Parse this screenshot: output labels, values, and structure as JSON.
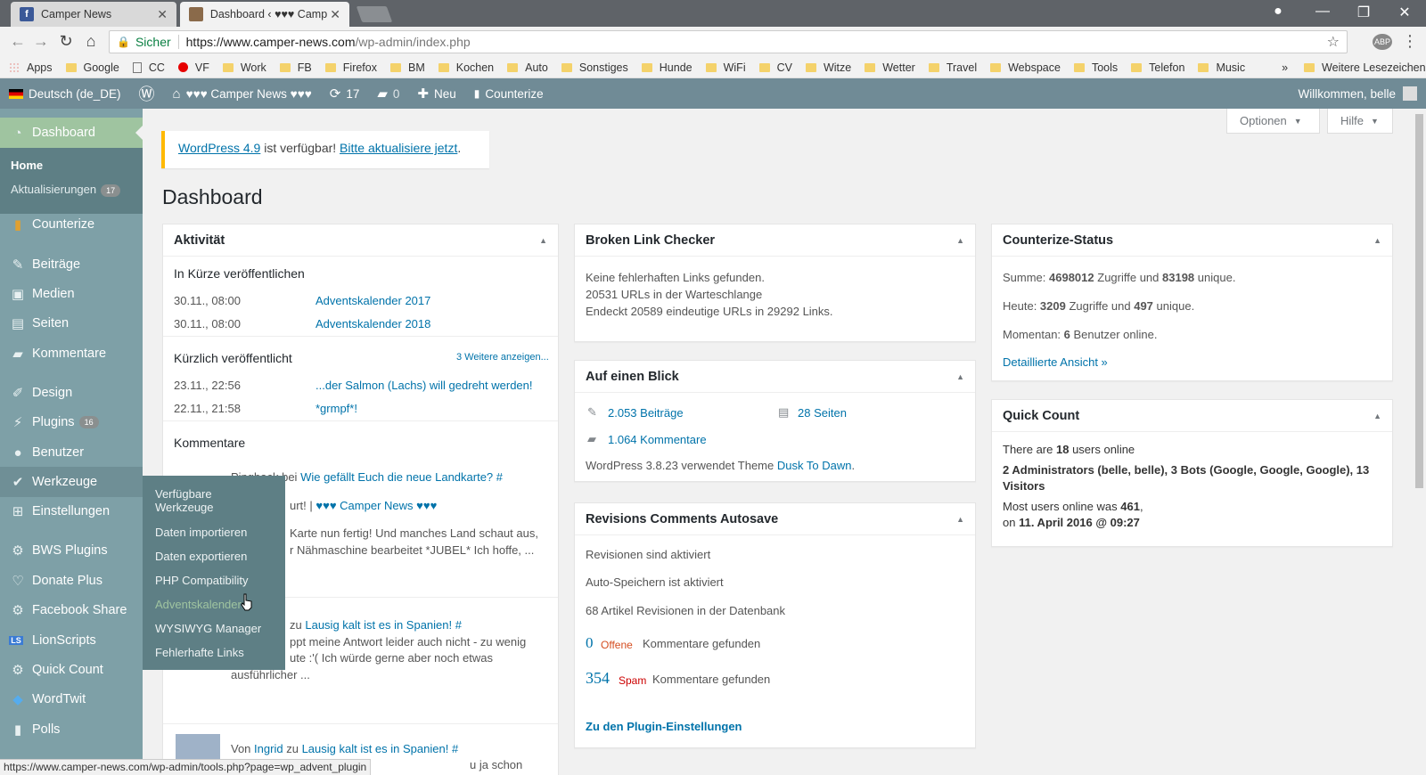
{
  "browser": {
    "tabs": [
      {
        "title": "Camper News"
      },
      {
        "title": "Dashboard ‹ ♥♥♥ Camp"
      }
    ],
    "address": {
      "secure_label": "Sicher",
      "host": "https://www.camper-news.com",
      "path": "/wp-admin/index.php"
    },
    "bookmarks": [
      "Apps",
      "Google",
      "CC",
      "VF",
      "Work",
      "FB",
      "Firefox",
      "BM",
      "Kochen",
      "Auto",
      "Sonstiges",
      "Hunde",
      "WiFi",
      "CV",
      "Witze",
      "Wetter",
      "Travel",
      "Webspace",
      "Tools",
      "Telefon",
      "Music"
    ],
    "bookmarks_more": "»",
    "bookmarks_other": "Weitere Lesezeichen",
    "status_url": "https://www.camper-news.com/wp-admin/tools.php?page=wp_advent_plugin"
  },
  "adminbar": {
    "language": "Deutsch (de_DE)",
    "site_name": "♥♥♥ Camper News ♥♥♥",
    "updates": "17",
    "comments": "0",
    "new_label": "Neu",
    "counterize": "Counterize",
    "welcome": "Willkommen, belle"
  },
  "sidebar": {
    "dashboard": "Dashboard",
    "home": "Home",
    "updates_label": "Aktualisierungen",
    "updates_count": "17",
    "items": [
      "Counterize",
      "Beiträge",
      "Medien",
      "Seiten",
      "Kommentare",
      "Design",
      "Plugins",
      "Benutzer",
      "Werkzeuge",
      "Einstellungen",
      "BWS Plugins",
      "Donate Plus",
      "Facebook Share",
      "LionScripts",
      "Quick Count",
      "WordTwit",
      "Polls"
    ],
    "plugins_count": "16",
    "tools_flyout": [
      "Verfügbare Werkzeuge",
      "Daten importieren",
      "Daten exportieren",
      "PHP Compatibility",
      "Adventskalender",
      "WYSIWYG Manager",
      "Fehlerhafte Links"
    ]
  },
  "screen": {
    "options": "Optionen",
    "help": "Hilfe"
  },
  "notice": {
    "link1": "WordPress 4.9",
    "text": " ist verfügbar! ",
    "link2": "Bitte aktualisiere jetzt",
    "end": "."
  },
  "page_title": "Dashboard",
  "activity": {
    "title": "Aktivität",
    "scheduled_title": "In Kürze veröffentlichen",
    "scheduled": [
      {
        "date": "30.11., 08:00",
        "title": "Adventskalender 2017"
      },
      {
        "date": "30.11., 08:00",
        "title": "Adventskalender 2018"
      }
    ],
    "recent_title": "Kürzlich veröffentlicht",
    "more_link": "3 Weitere anzeigen...",
    "recent": [
      {
        "date": "23.11., 22:56",
        "title": "...der Salmon (Lachs) will gedreht werden!"
      },
      {
        "date": "22.11., 21:58",
        "title": "*grmpf*!"
      }
    ],
    "comments_title": "Kommentare",
    "c1_prefix": "Pingback bei",
    "c1_link": "Wie gefällt Euch die neue Landkarte? #",
    "c1_line2_a": "urt! | ",
    "c1_line2_b": "♥♥♥ Camper News ♥♥♥",
    "c1_line3": "Karte nun fertig! Und manches Land schaut aus,",
    "c1_line4": "r Nähmaschine bearbeitet *JUBEL* Ich hoffe, ...",
    "c2_prefix": "zu",
    "c2_link": "Lausig kalt ist es in Spanien! #",
    "c2_line2": "ppt meine Antwort leider auch nicht - zu wenig",
    "c2_line3": "ute :'( Ich würde gerne aber noch etwas",
    "c2_line4": "ausführlicher ...",
    "c3_prefix": "Von",
    "c3_author": "Ingrid",
    "c3_mid": "zu",
    "c3_link": "Lausig kalt ist es in Spanien! #",
    "c3_line2": "u ja schon"
  },
  "blc": {
    "title": "Broken Link Checker",
    "lines": [
      "Keine fehlerhaften Links gefunden.",
      "20531 URLs in der Warteschlange",
      "Endeckt 20589 eindeutige URLs in 29292 Links."
    ]
  },
  "glance": {
    "title": "Auf einen Blick",
    "posts": "2.053 Beiträge",
    "pages": "28 Seiten",
    "comments": "1.064 Kommentare",
    "wp_text": "WordPress 3.8.23 verwendet Theme ",
    "theme": "Dusk To Dawn",
    "end": "."
  },
  "revisions": {
    "title": "Revisions Comments Autosave",
    "l1": "Revisionen sind aktiviert",
    "l2": "Auto-Speichern ist aktiviert",
    "l3": "68 Artikel Revisionen in der Datenbank",
    "open_count": "0",
    "open_label": "Offene",
    "found_text": "Kommentare gefunden",
    "spam_count": "354",
    "spam_label": "Spam",
    "settings_link": "Zu den Plugin-Einstellungen"
  },
  "counterize_status": {
    "title": "Counterize-Status",
    "summe_label": "Summe: ",
    "summe_hits": "4698012",
    "hits_text": " Zugriffe und ",
    "summe_unique": "83198",
    "unique_text": " unique.",
    "heute_label": "Heute: ",
    "heute_hits": "3209",
    "heute_unique": "497",
    "momentan_label": "Momentan: ",
    "momentan_count": "6",
    "momentan_text": " Benutzer online.",
    "detail_link": "Detaillierte Ansicht »"
  },
  "quick_count": {
    "title": "Quick Count",
    "online_a": "There are ",
    "online_n": "18",
    "online_b": " users online",
    "breakdown_1": "2 Administrators (belle, belle), 3 Bots (Google, Google, Google), 13",
    "breakdown_2": "Visitors",
    "most_a": "Most users online was ",
    "most_n": "461",
    "most_b": ",",
    "on_a": "on ",
    "on_date": "11. April 2016 @ 09:27"
  },
  "colors": {
    "adminbar": "#708b96",
    "sidebar": "#7ea0a7",
    "accent": "#9fc4a0",
    "link": "#0073aa"
  }
}
